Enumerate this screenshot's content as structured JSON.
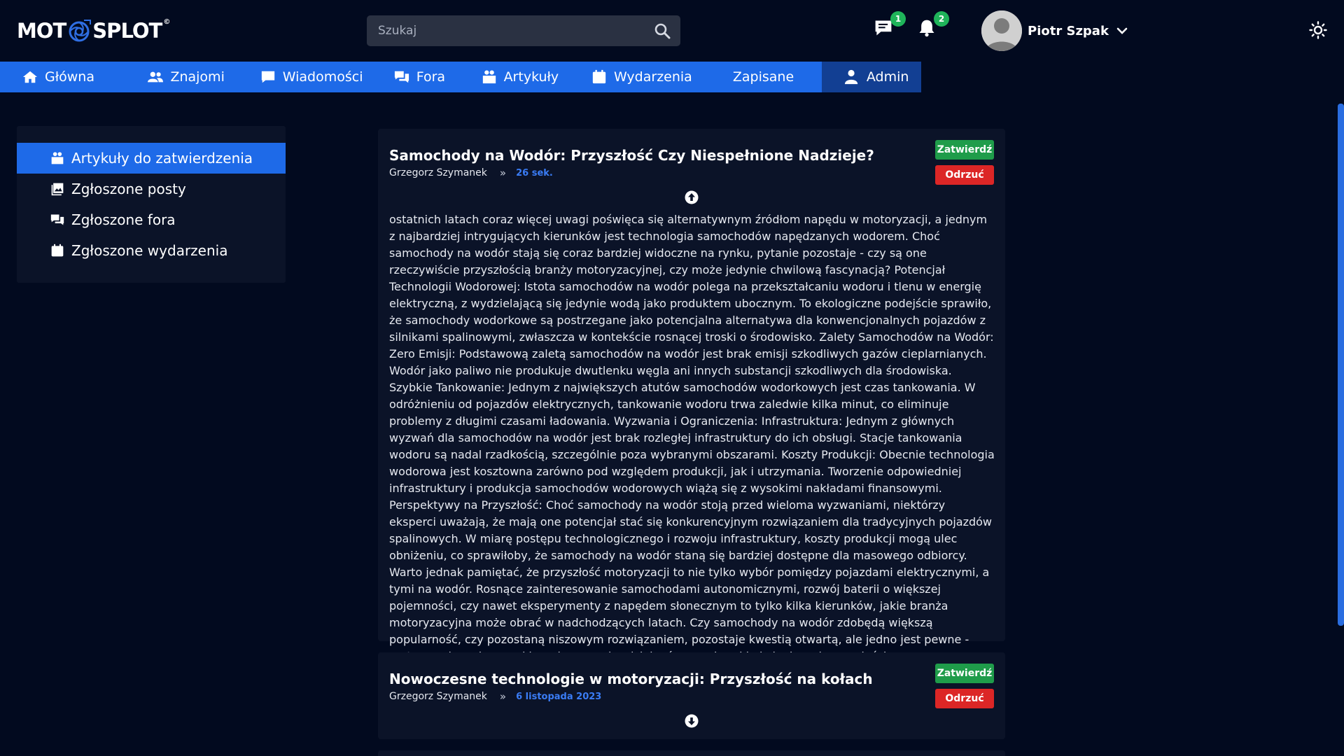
{
  "header": {
    "logo_text_left": "MOT",
    "logo_text_right": "SPLOT",
    "logo_reg": "©",
    "search_placeholder": "Szukaj",
    "messages_badge": "1",
    "notifications_badge": "2",
    "user_name": "Piotr Szpak"
  },
  "nav": {
    "items": [
      {
        "label": "Główna",
        "icon": "home-icon"
      },
      {
        "label": "Znajomi",
        "icon": "users-icon"
      },
      {
        "label": "Wiadomości",
        "icon": "message-icon"
      },
      {
        "label": "Fora",
        "icon": "forum-icon"
      },
      {
        "label": "Artykuły",
        "icon": "articles-icon"
      },
      {
        "label": "Wydarzenia",
        "icon": "calendar-icon"
      },
      {
        "label": "Zapisane",
        "icon": "bookmark-icon"
      },
      {
        "label": "Admin",
        "icon": "admin-icon"
      }
    ],
    "active": "Admin"
  },
  "sidebar": {
    "items": [
      {
        "label": "Artykuły do zatwierdzenia",
        "icon": "articles-icon"
      },
      {
        "label": "Zgłoszone posty",
        "icon": "image-post-icon"
      },
      {
        "label": "Zgłoszone fora",
        "icon": "forum-icon"
      },
      {
        "label": "Zgłoszone wydarzenia",
        "icon": "calendar-icon"
      }
    ],
    "active": "Artykuły do zatwierdzenia"
  },
  "articles": [
    {
      "title": "Samochody na Wodór: Przyszłość Czy Niespełnione Nadzieje?",
      "author": "Grzegorz Szymanek",
      "separator": "»",
      "date": "26 sek.",
      "approve_label": "Zatwierdź",
      "reject_label": "Odrzuć",
      "expanded": true,
      "body": "ostatnich latach coraz więcej uwagi poświęca się alternatywnym źródłom napędu w motoryzacji, a jednym z najbardziej intrygujących kierunków jest technologia samochodów napędzanych wodorem. Choć samochody na wodór stają się coraz bardziej widoczne na rynku, pytanie pozostaje - czy są one rzeczywiście przyszłością branży motoryzacyjnej, czy może jedynie chwilową fascynacją? Potencjał Technologii Wodorowej: Istota samochodów na wodór polega na przekształcaniu wodoru i tlenu w energię elektryczną, z wydzielającą się jedynie wodą jako produktem ubocznym. To ekologiczne podejście sprawiło, że samochody wodorkowe są postrzegane jako potencjalna alternatywa dla konwencjonalnych pojazdów z silnikami spalinowymi, zwłaszcza w kontekście rosnącej troski o środowisko. Zalety Samochodów na Wodór: Zero Emisji: Podstawową zaletą samochodów na wodór jest brak emisji szkodliwych gazów cieplarnianych. Wodór jako paliwo nie produkuje dwutlenku węgla ani innych substancji szkodliwych dla środowiska. Szybkie Tankowanie: Jednym z największych atutów samochodów wodorkowych jest czas tankowania. W odróżnieniu od pojazdów elektrycznych, tankowanie wodoru trwa zaledwie kilka minut, co eliminuje problemy z długimi czasami ładowania. Wyzwania i Ograniczenia: Infrastruktura: Jednym z głównych wyzwań dla samochodów na wodór jest brak rozległej infrastruktury do ich obsługi. Stacje tankowania wodoru są nadal rzadkością, szczególnie poza wybranymi obszarami. Koszty Produkcji: Obecnie technologia wodorowa jest kosztowna zarówno pod względem produkcji, jak i utrzymania. Tworzenie odpowiedniej infrastruktury i produkcja samochodów wodorowych wiążą się z wysokimi nakładami finansowymi. Perspektywy na Przyszłość: Choć samochody na wodór stoją przed wieloma wyzwaniami, niektórzy eksperci uważają, że mają one potencjał stać się konkurencyjnym rozwiązaniem dla tradycyjnych pojazdów spalinowych. W miarę postępu technologicznego i rozwoju infrastruktury, koszty produkcji mogą ulec obniżeniu, co sprawiłoby, że samochody na wodór staną się bardziej dostępne dla masowego odbiorcy. Warto jednak pamiętać, że przyszłość motoryzacji to nie tylko wybór pomiędzy pojazdami elektrycznymi, a tymi na wodór. Rosnące zainteresowanie samochodami autonomicznymi, rozwój baterii o większej pojemności, czy nawet eksperymenty z napędem słonecznym to tylko kilka kierunków, jakie branża motoryzacyjna może obrać w nadchodzących latach. Czy samochody na wodór zdobędą większą popularność, czy pozostaną niszowym rozwiązaniem, pozostaje kwestią otwartą, ale jedno jest pewne - motoryzacja zmierza w kierunku coraz bardziej zrównoważonej i ekologicznej przyszłości."
    },
    {
      "title": "Nowoczesne technologie w motoryzacji: Przyszłość na kołach",
      "author": "Grzegorz Szymanek",
      "separator": "»",
      "date": "6 listopada 2023",
      "approve_label": "Zatwierdź",
      "reject_label": "Odrzuć",
      "expanded": false
    }
  ],
  "colors": {
    "background": "#020a1f",
    "card": "#0b1328",
    "accent": "#1e6ae8",
    "nav_active": "#123f93",
    "approve": "#1f9c4a",
    "reject": "#dc2626",
    "badge": "#1fb45a",
    "date": "#3a7cf5"
  }
}
